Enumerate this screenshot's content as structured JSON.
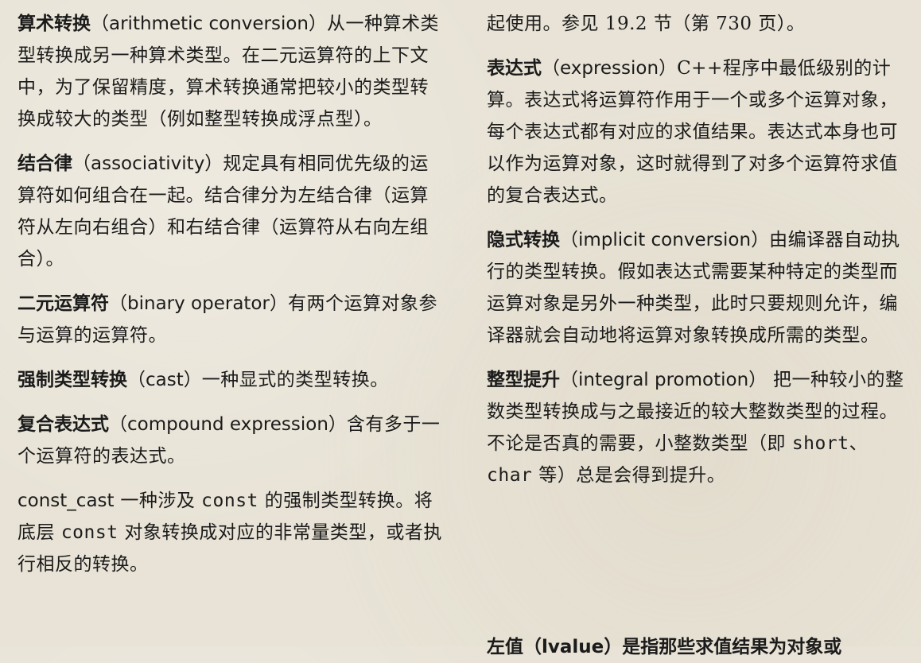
{
  "left": [
    {
      "term": "算术转换",
      "eng": "（arithmetic conversion）",
      "rest": "从一种算术类型转换成另一种算术类型。在二元运算符的上下文中，为了保留精度，算术转换通常把较小的类型转换成较大的类型（例如整型转换成浮点型）。"
    },
    {
      "term": "结合律",
      "eng": "（associativity）",
      "rest": "规定具有相同优先级的运算符如何组合在一起。结合律分为左结合律（运算符从左向右组合）和右结合律（运算符从右向左组合）。"
    },
    {
      "term": "二元运算符",
      "eng": "（binary operator）",
      "rest": "有两个运算对象参与运算的运算符。"
    },
    {
      "term": "强制类型转换",
      "eng": "（cast）",
      "rest": "一种显式的类型转换。"
    },
    {
      "term": "复合表达式",
      "eng": "（compound expression）",
      "rest": "含有多于一个运算符的表达式。"
    },
    {
      "term": "const_cast",
      "rest1": " 一种涉及 ",
      "mono1": "const",
      "rest2": " 的强制类型转换。将底层 ",
      "mono2": "const",
      "rest3": " 对象转换成对应的非常量类型，或者执行相反的转换。"
    }
  ],
  "right": {
    "continuation": "起使用。参见 19.2 节（第 730 页）。",
    "entries": [
      {
        "term": "表达式",
        "eng": "（expression）",
        "rest": "C++程序中最低级别的计算。表达式将运算符作用于一个或多个运算对象，每个表达式都有对应的求值结果。表达式本身也可以作为运算对象，这时就得到了对多个运算符求值的复合表达式。"
      },
      {
        "term": "隐式转换",
        "eng": "（implicit conversion）",
        "rest": "由编译器自动执行的类型转换。假如表达式需要某种特定的类型而运算对象是另外一种类型，此时只要规则允许，编译器就会自动地将运算对象转换成所需的类型。"
      },
      {
        "term": "整型提升",
        "eng": "（integral promotion）",
        "rest1": " 把一种较小的整数类型转换成与之最接近的较大整数类型的过程。不论是否真的需要，小整数类型（即 ",
        "mono1": "short",
        "sep": "、",
        "mono2": "char",
        "rest2": " 等）总是会得到提升。"
      }
    ],
    "cut_line": "左值（lvalue）是指那些求值结果为对象或"
  }
}
